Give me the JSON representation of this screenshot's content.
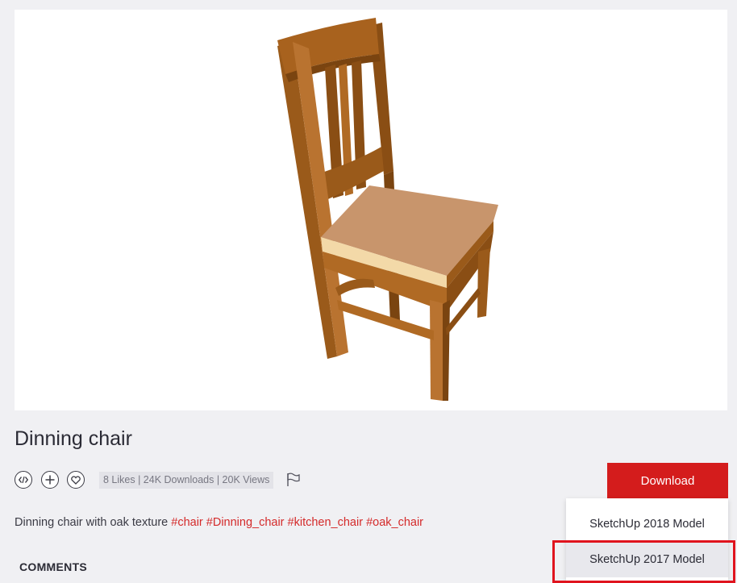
{
  "model": {
    "title": "Dinning chair",
    "stats": "8 Likes | 24K Downloads | 20K Views",
    "description": "Dinning chair with oak texture",
    "tags": [
      "#chair",
      "#Dinning_chair",
      "#kitchen_chair",
      "#oak_chair"
    ]
  },
  "actions": {
    "embed_icon": "code-icon",
    "collect_icon": "plus-icon",
    "like_icon": "heart-icon",
    "report_icon": "flag-icon"
  },
  "download": {
    "label": "Download",
    "options": [
      "SketchUp 2018 Model",
      "SketchUp 2017 Model"
    ]
  },
  "comments_heading": "COMMENTS",
  "colors": {
    "accent": "#d41c1c",
    "highlight": "#e0141e",
    "background": "#f0f0f3"
  }
}
